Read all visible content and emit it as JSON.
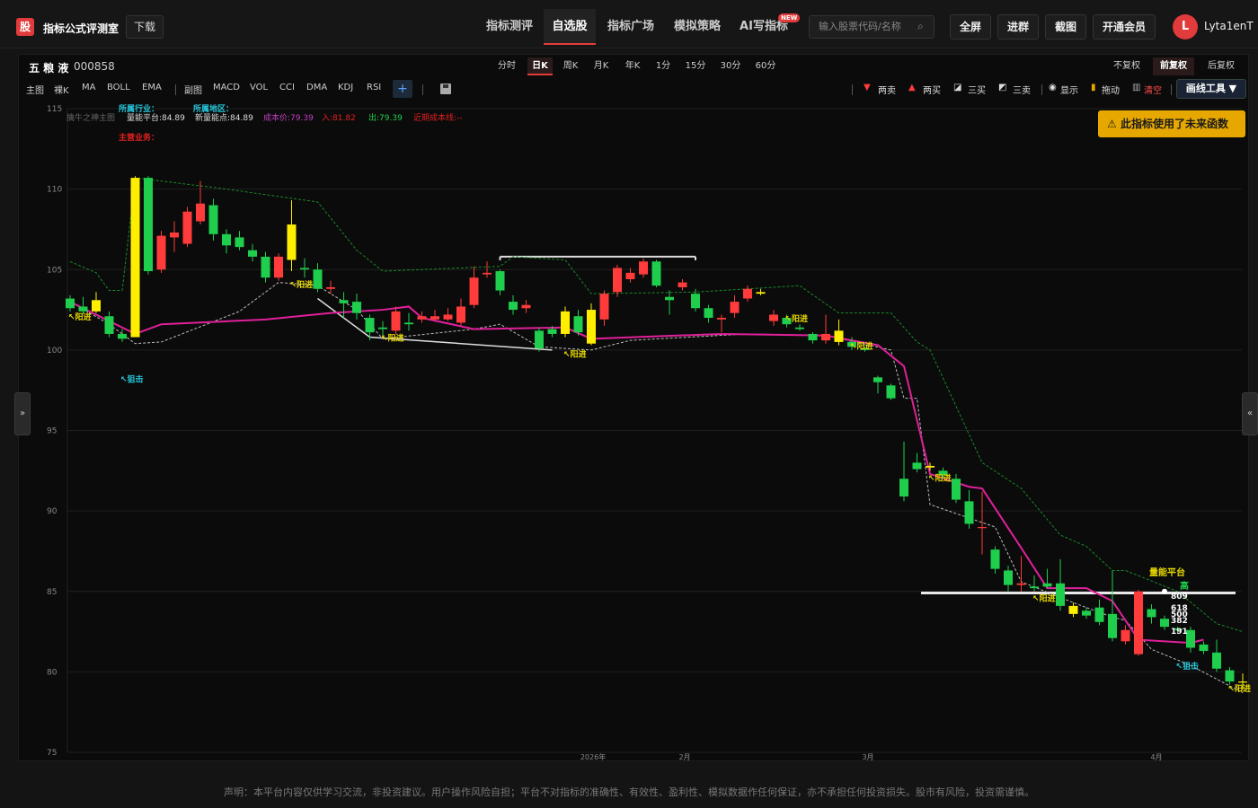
{
  "app": {
    "logo_char": "股",
    "title": "指标公式评测室",
    "download": "下载"
  },
  "nav": [
    {
      "label": "指标测评",
      "active": false
    },
    {
      "label": "自选股",
      "active": true
    },
    {
      "label": "指标广场",
      "active": false
    },
    {
      "label": "模拟策略",
      "active": false
    },
    {
      "label": "AI写指标",
      "active": false,
      "badge": "NEW"
    }
  ],
  "search": {
    "placeholder": "输入股票代码/名称",
    "icon": "search-icon"
  },
  "top_buttons": [
    "全屏",
    "进群",
    "截图",
    "开通会员"
  ],
  "user": {
    "avatar": "L",
    "name": "Lyta1enT"
  },
  "stock": {
    "name": "五 粮 液",
    "code": "000858"
  },
  "periods": [
    {
      "label": "分时",
      "active": false
    },
    {
      "label": "日K",
      "active": true
    },
    {
      "label": "周K",
      "active": false
    },
    {
      "label": "月K",
      "active": false
    },
    {
      "label": "年K",
      "active": false
    },
    {
      "label": "1分",
      "active": false
    },
    {
      "label": "15分",
      "active": false
    },
    {
      "label": "30分",
      "active": false
    },
    {
      "label": "60分",
      "active": false
    }
  ],
  "adjust": [
    {
      "label": "不复权",
      "active": false
    },
    {
      "label": "前复权",
      "active": true
    },
    {
      "label": "后复权",
      "active": false
    }
  ],
  "main_indicators": [
    "主图",
    "裸K",
    "MA",
    "BOLL",
    "EMA"
  ],
  "sub_indicators": [
    "副图",
    "MACD",
    "VOL",
    "CCI",
    "DMA",
    "KDJ",
    "RSI"
  ],
  "plus": "+",
  "tools": [
    {
      "label": "两卖",
      "icon": "down-triangle-icon",
      "color": "#ff3b3b"
    },
    {
      "label": "两买",
      "icon": "up-triangle-icon",
      "color": "#ff3b3b"
    },
    {
      "label": "三买",
      "icon": "buy-mark-icon",
      "color": "#ddd"
    },
    {
      "label": "三卖",
      "icon": "sell-mark-icon",
      "color": "#ddd"
    },
    {
      "label": "显示",
      "icon": "eye-icon",
      "color": "#ddd"
    },
    {
      "label": "拖动",
      "icon": "lock-icon",
      "color": "#ddd"
    },
    {
      "label": "清空",
      "icon": "trash-icon",
      "color": "#ff4d4d"
    }
  ],
  "draw_tool": "画线工具 ▼",
  "warning": "此指标使用了未来函数",
  "legend": {
    "industry": "所属行业：",
    "region": "所属地区：",
    "business": "主营业务：",
    "indicator_name": "擒牛之神主图",
    "platform": "量能平台:84.89",
    "new_point": "新量能点:84.89",
    "cost": "成本价:79.39",
    "entry": "入:81.82",
    "exit": "出:79.39",
    "recent_cost": "近期成本线:--"
  },
  "annotations": {
    "buy_tag": "↖阳进",
    "sniper_tag": "↖狙击",
    "platform_label": "量能平台",
    "high_label": "高",
    "fib_levels": [
      "809",
      "618",
      "500",
      "382",
      "191"
    ]
  },
  "chart_data": {
    "type": "candlestick",
    "ylim": [
      75,
      115
    ],
    "y_ticks": [
      115,
      110,
      105,
      100,
      95,
      90,
      85,
      80,
      75
    ],
    "x_labels": [
      "2026年",
      "2月",
      "3月",
      "4月"
    ],
    "up_color": "#ff3b3b",
    "down_color": "#1fce4c",
    "candles": [
      [
        103.2,
        102.6,
        103.4,
        102.4
      ],
      [
        102.7,
        102.4,
        103.3,
        102.2
      ],
      [
        102.4,
        103.1,
        103.6,
        102.3
      ],
      [
        102.1,
        101.0,
        102.4,
        100.8
      ],
      [
        101.0,
        100.7,
        101.3,
        100.5
      ],
      [
        100.8,
        110.7,
        110.8,
        100.8
      ],
      [
        110.7,
        104.9,
        110.8,
        104.7
      ],
      [
        105.0,
        107.1,
        107.4,
        104.8
      ],
      [
        107.0,
        107.3,
        108.0,
        106.1
      ],
      [
        106.6,
        108.6,
        108.9,
        106.4
      ],
      [
        108.0,
        109.1,
        110.5,
        107.8
      ],
      [
        109.0,
        107.2,
        109.4,
        106.8
      ],
      [
        107.2,
        106.5,
        107.5,
        106.0
      ],
      [
        107.0,
        106.4,
        107.4,
        106.2
      ],
      [
        106.2,
        105.8,
        106.6,
        105.5
      ],
      [
        105.8,
        104.5,
        106.1,
        104.2
      ],
      [
        104.5,
        105.8,
        106.0,
        104.3
      ],
      [
        105.6,
        107.8,
        109.3,
        104.9
      ],
      [
        105.1,
        105.0,
        105.7,
        104.5
      ],
      [
        105.0,
        103.8,
        105.4,
        103.6
      ],
      [
        103.8,
        103.9,
        104.3,
        103.5
      ],
      [
        103.1,
        102.9,
        103.6,
        102.0
      ],
      [
        103.0,
        102.3,
        103.5,
        101.9
      ],
      [
        102.0,
        101.1,
        102.2,
        100.6
      ],
      [
        101.4,
        101.3,
        101.8,
        100.9
      ],
      [
        101.2,
        102.4,
        102.7,
        101.0
      ],
      [
        101.7,
        101.6,
        102.3,
        101.2
      ],
      [
        101.9,
        102.1,
        102.4,
        101.7
      ],
      [
        101.9,
        102.1,
        102.5,
        101.8
      ],
      [
        101.9,
        102.2,
        102.6,
        101.8
      ],
      [
        101.7,
        102.7,
        103.2,
        101.5
      ],
      [
        102.8,
        104.5,
        105.2,
        102.6
      ],
      [
        104.7,
        104.8,
        105.5,
        104.5
      ],
      [
        104.9,
        103.7,
        105.0,
        103.4
      ],
      [
        103.0,
        102.5,
        103.4,
        102.2
      ],
      [
        102.6,
        102.8,
        103.1,
        102.3
      ],
      [
        101.2,
        100.1,
        101.4,
        99.9
      ],
      [
        101.3,
        101.0,
        101.5,
        100.8
      ],
      [
        101.0,
        102.4,
        102.7,
        100.8
      ],
      [
        102.1,
        101.1,
        102.5,
        100.9
      ],
      [
        100.4,
        102.5,
        102.9,
        100.3
      ],
      [
        101.9,
        103.5,
        103.7,
        101.5
      ],
      [
        103.6,
        105.1,
        105.3,
        103.3
      ],
      [
        104.4,
        104.8,
        105.1,
        104.2
      ],
      [
        104.7,
        105.5,
        105.7,
        104.5
      ],
      [
        105.5,
        104.0,
        105.6,
        103.9
      ],
      [
        103.3,
        103.1,
        103.7,
        102.2
      ],
      [
        103.9,
        104.2,
        104.4,
        103.7
      ],
      [
        103.5,
        102.6,
        103.8,
        102.4
      ],
      [
        102.6,
        102.0,
        102.8,
        101.7
      ],
      [
        101.9,
        102.0,
        102.2,
        101.1
      ],
      [
        102.3,
        103.0,
        103.4,
        102.0
      ],
      [
        103.2,
        103.8,
        104.0,
        103.0
      ],
      [
        103.6,
        103.5,
        103.8,
        103.4
      ],
      [
        101.8,
        102.2,
        102.5,
        101.5
      ],
      [
        102.0,
        101.6,
        102.2,
        101.4
      ],
      [
        101.4,
        101.3,
        101.6,
        101.2
      ],
      [
        101.0,
        100.6,
        101.1,
        100.4
      ],
      [
        100.6,
        101.0,
        102.2,
        100.4
      ],
      [
        100.5,
        101.2,
        101.9,
        100.3
      ],
      [
        100.5,
        100.2,
        100.8,
        100.0
      ],
      [
        100.1,
        100.0,
        100.2,
        99.9
      ],
      [
        98.3,
        98.0,
        98.4,
        97.3
      ],
      [
        97.8,
        97.0,
        97.9,
        96.9
      ],
      [
        92.0,
        90.9,
        94.3,
        90.6
      ],
      [
        93.0,
        92.6,
        93.6,
        92.4
      ],
      [
        92.8,
        92.7,
        93.0,
        92.5
      ],
      [
        92.5,
        92.2,
        92.7,
        92.0
      ],
      [
        92.0,
        90.7,
        92.3,
        90.5
      ],
      [
        90.6,
        89.2,
        91.3,
        88.9
      ],
      [
        89.0,
        89.0,
        91.2,
        87.3
      ],
      [
        87.6,
        86.4,
        87.8,
        86.1
      ],
      [
        86.3,
        85.4,
        86.6,
        85.0
      ],
      [
        85.4,
        85.5,
        87.2,
        85.0
      ],
      [
        85.3,
        85.2,
        86.0,
        85.0
      ],
      [
        85.5,
        85.3,
        86.4,
        85.2
      ],
      [
        85.5,
        84.1,
        87.0,
        83.8
      ],
      [
        83.6,
        84.1,
        84.3,
        83.4
      ],
      [
        83.8,
        83.5,
        84.0,
        83.3
      ],
      [
        84.0,
        83.1,
        84.5,
        82.9
      ],
      [
        83.6,
        82.1,
        86.3,
        81.9
      ],
      [
        81.9,
        82.6,
        82.9,
        81.7
      ],
      [
        81.1,
        85.0,
        85.1,
        81.0
      ],
      [
        83.9,
        83.4,
        84.2,
        83.0
      ],
      [
        83.3,
        82.8,
        83.5,
        82.6
      ],
      [
        82.7,
        82.6,
        82.8,
        82.4
      ],
      [
        82.6,
        81.5,
        82.8,
        81.2
      ],
      [
        81.7,
        81.3,
        81.9,
        81.1
      ],
      [
        81.2,
        80.2,
        82.0,
        80.0
      ],
      [
        80.1,
        79.4,
        80.3,
        79.2
      ],
      [
        79.4,
        79.4,
        79.9,
        78.9
      ]
    ],
    "yellow_indices": [
      2,
      5,
      17,
      38,
      40,
      53,
      59,
      66,
      77,
      90
    ],
    "resistance_white_1": {
      "y": 105.8,
      "from": 33,
      "to": 48
    },
    "resistance_white_2": {
      "y": 84.9,
      "from": 68,
      "to": 90
    },
    "green_dashed_upper": [
      [
        0,
        105.5
      ],
      [
        2,
        104.8
      ],
      [
        3,
        103.7
      ],
      [
        4,
        103.7
      ],
      [
        5,
        110.7
      ],
      [
        12,
        110.0
      ],
      [
        19,
        109.2
      ],
      [
        22,
        106.2
      ],
      [
        24,
        104.9
      ],
      [
        33,
        105.2
      ],
      [
        34,
        105.8
      ],
      [
        38,
        105.6
      ],
      [
        40,
        103.5
      ],
      [
        48,
        103.6
      ],
      [
        56,
        104.0
      ],
      [
        59,
        102.3
      ],
      [
        63,
        102.3
      ],
      [
        65,
        100.5
      ],
      [
        66,
        100.0
      ],
      [
        70,
        93.0
      ],
      [
        73,
        91.4
      ],
      [
        76,
        88.5
      ],
      [
        78,
        87.8
      ],
      [
        80,
        86.3
      ],
      [
        81,
        86.3
      ],
      [
        85,
        85.0
      ],
      [
        88,
        83.0
      ],
      [
        90,
        82.5
      ]
    ],
    "magenta_line": [
      [
        0,
        103.0
      ],
      [
        5,
        101.0
      ],
      [
        7,
        101.6
      ],
      [
        15,
        101.9
      ],
      [
        20,
        102.3
      ],
      [
        24,
        102.5
      ],
      [
        26,
        102.7
      ],
      [
        27,
        102.0
      ],
      [
        31,
        101.3
      ],
      [
        38,
        101.4
      ],
      [
        40,
        100.7
      ],
      [
        50,
        101.0
      ],
      [
        58,
        100.9
      ],
      [
        60,
        100.6
      ],
      [
        62,
        100.3
      ],
      [
        64,
        99.0
      ],
      [
        66,
        92.3
      ],
      [
        69,
        91.5
      ],
      [
        70,
        91.4
      ],
      [
        73,
        87.7
      ],
      [
        75,
        85.2
      ],
      [
        78,
        85.2
      ],
      [
        80,
        84.4
      ],
      [
        81,
        83.2
      ],
      [
        82,
        82.0
      ],
      [
        86,
        81.8
      ],
      [
        87,
        82.0
      ]
    ],
    "gray_dashed_lower": [
      [
        0,
        103.0
      ],
      [
        3,
        101.6
      ],
      [
        5,
        100.4
      ],
      [
        7,
        100.5
      ],
      [
        13,
        102.4
      ],
      [
        16,
        104.2
      ],
      [
        19,
        104.0
      ],
      [
        22,
        102.5
      ],
      [
        24,
        100.7
      ],
      [
        31,
        101.3
      ],
      [
        33,
        101.6
      ],
      [
        36,
        100.2
      ],
      [
        40,
        100.0
      ],
      [
        43,
        100.6
      ],
      [
        52,
        101.0
      ],
      [
        58,
        100.9
      ],
      [
        63,
        100.0
      ],
      [
        64,
        97.0
      ],
      [
        65,
        97.0
      ],
      [
        66,
        90.4
      ],
      [
        71,
        89.0
      ],
      [
        73,
        85.6
      ],
      [
        77,
        84.3
      ],
      [
        80,
        83.4
      ],
      [
        81,
        83.2
      ],
      [
        83,
        81.4
      ],
      [
        86,
        80.4
      ],
      [
        90,
        78.7
      ]
    ],
    "white_diag": [
      [
        19,
        103.2
      ],
      [
        23,
        100.8
      ],
      [
        37,
        100.0
      ]
    ],
    "buy_tags": [
      [
        0,
        102.0
      ],
      [
        17,
        104.0
      ],
      [
        24,
        100.7
      ],
      [
        38,
        99.7
      ],
      [
        55,
        101.9
      ],
      [
        60,
        100.2
      ],
      [
        66,
        92.0
      ],
      [
        74,
        84.5
      ],
      [
        89,
        78.9
      ]
    ],
    "sniper_tags": [
      [
        4,
        98.0
      ],
      [
        85,
        80.2
      ]
    ],
    "highlight_dot": [
      84,
      85.0
    ]
  },
  "disclaimer": "声明：本平台内容仅供学习交流，非投资建议。用户操作风险自担；平台不对指标的准确性、有效性、盈利性、模拟数据作任何保证，亦不承担任何投资损失。股市有风险，投资需谨慎。"
}
